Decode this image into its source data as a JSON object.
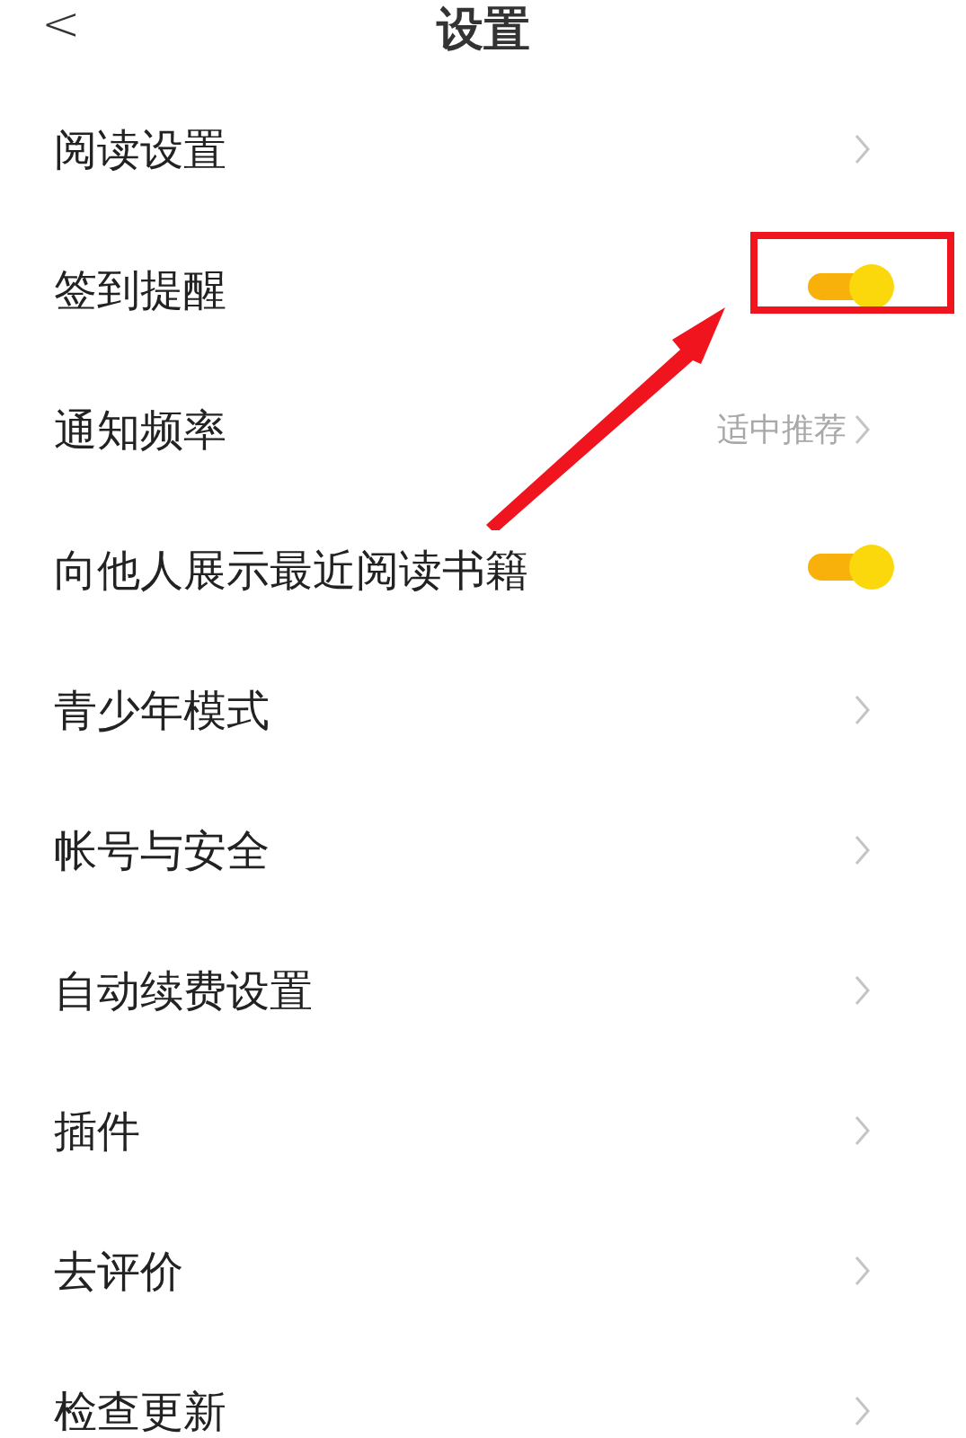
{
  "header": {
    "back": "<",
    "title": "设置"
  },
  "rows": [
    {
      "kind": "link",
      "label": "阅读设置"
    },
    {
      "kind": "toggle",
      "label": "签到提醒",
      "on": true
    },
    {
      "kind": "link",
      "label": "通知频率",
      "value": "适中推荐"
    },
    {
      "kind": "toggle",
      "label": "向他人展示最近阅读书籍",
      "on": true
    },
    {
      "kind": "link",
      "label": "青少年模式"
    },
    {
      "kind": "link",
      "label": "帐号与安全"
    },
    {
      "kind": "link",
      "label": "自动续费设置"
    },
    {
      "kind": "link",
      "label": "插件"
    },
    {
      "kind": "link",
      "label": "去评价"
    },
    {
      "kind": "link",
      "label": "检查更新"
    }
  ]
}
